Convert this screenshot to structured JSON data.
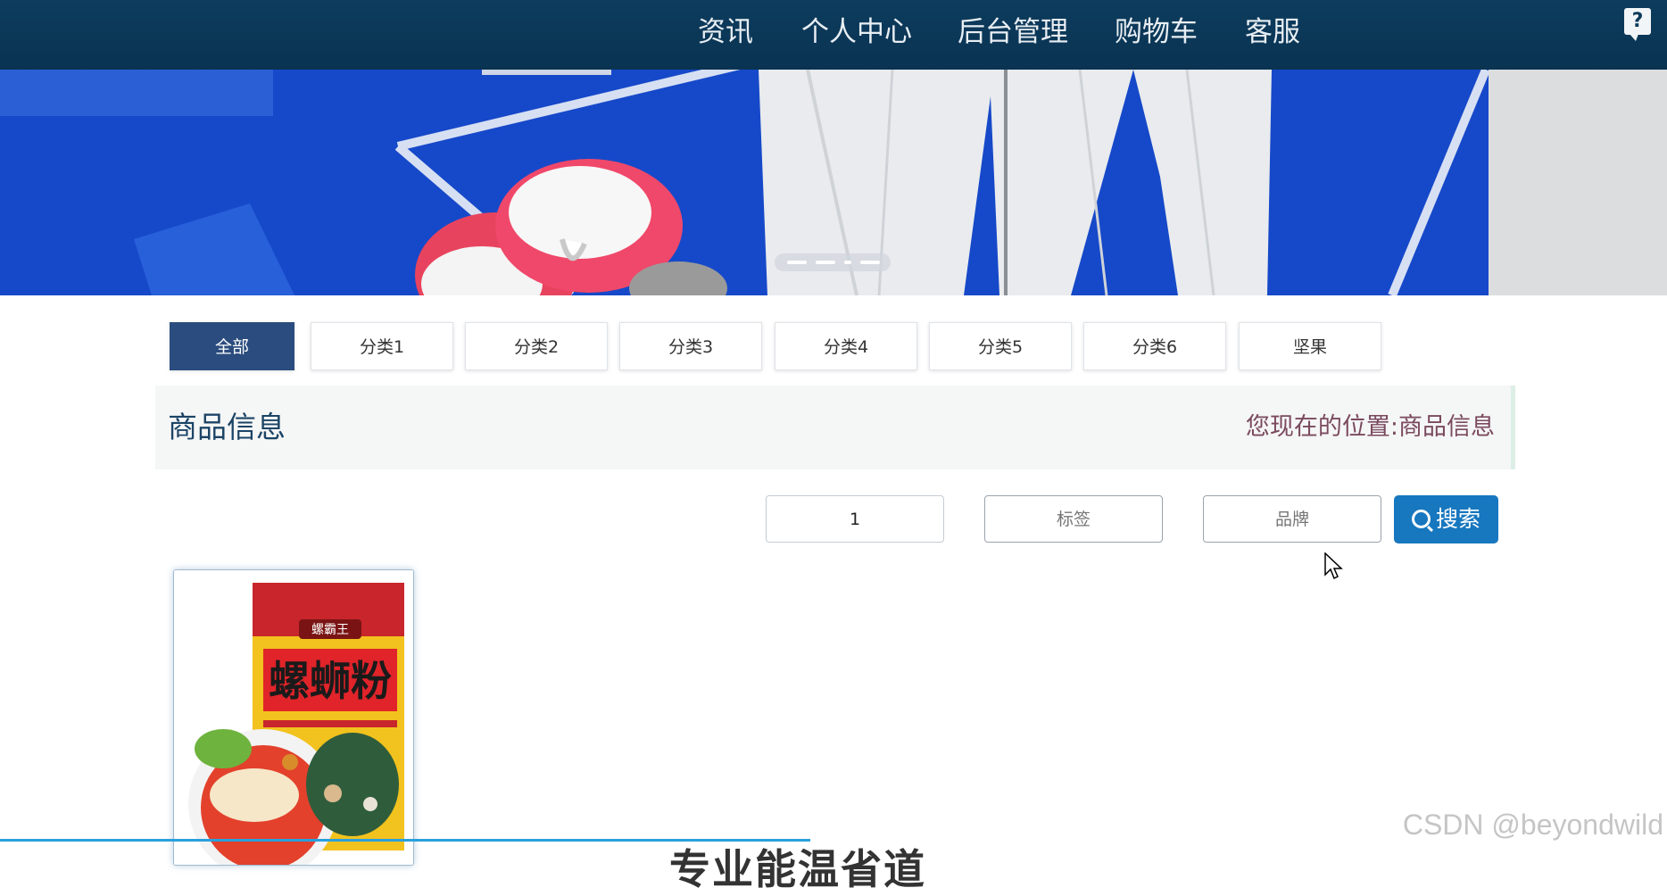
{
  "nav": {
    "items": [
      "资讯",
      "个人中心",
      "后台管理",
      "购物车",
      "客服"
    ],
    "help_icon": "?"
  },
  "banner": {
    "icon": "banner-image"
  },
  "categories": [
    "全部",
    "分类1",
    "分类2",
    "分类3",
    "分类4",
    "分类5",
    "分类6",
    "坚果"
  ],
  "section": {
    "title": "商品信息",
    "breadcrumb_prefix": "您现在的位置:",
    "breadcrumb_current": "商品信息"
  },
  "search": {
    "name_value": "1",
    "tag_placeholder": "标签",
    "brand_placeholder": "品牌",
    "button_label": "搜索"
  },
  "product": {
    "package_text": "螺蛳粉",
    "brand_text": "螺霸王"
  },
  "bottom_partial_text": "专业能温省道",
  "watermark": "CSDN @beyondwild",
  "colors": {
    "nav_bg": "#0c3a5a",
    "active_tab": "#2b4c7e",
    "search_button": "#1777bf",
    "banner_blue": "#1649c9"
  }
}
